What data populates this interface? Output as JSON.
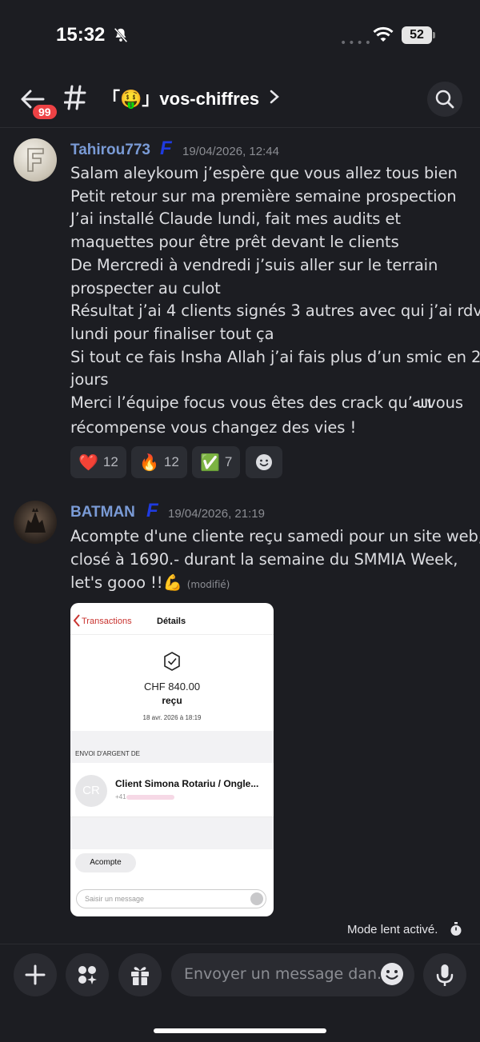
{
  "status_bar": {
    "time": "15:32",
    "battery": "52"
  },
  "header": {
    "unread_count": "99",
    "channel_name": "「🤑」vos-chiffres"
  },
  "messages": [
    {
      "author": "Tahirou773",
      "role_badge": "F",
      "avatar_letter": "F",
      "timestamp": "19/04/2026, 12:44",
      "lines": [
        "Salam aleykoum j’espère que vous allez tous bien",
        "Petit retour sur ma première semaine prospection",
        "J’ai installé Claude lundi, fait mes audits et",
        "maquettes pour être prêt devant le clients",
        "De Mercredi à vendredi j’suis aller sur le terrain",
        "prospecter au culot",
        "Résultat j’ai 4 clients signés 3 autres avec qui j’ai rdv",
        "lundi pour finaliser tout ça",
        "Si tout ce fais Insha Allah j’ai fais plus d’un smic en 2",
        "jours",
        "Merci l’équipe focus vous êtes des crack qu’ﷲ vous",
        "récompense vous changez des vies !"
      ],
      "reactions": [
        {
          "emoji": "❤️",
          "count": "12"
        },
        {
          "emoji": "🔥",
          "count": "12"
        },
        {
          "emoji": "✅",
          "count": "7"
        }
      ]
    },
    {
      "author": "BATMAN",
      "role_badge": "F",
      "timestamp": "19/04/2026, 21:19",
      "lines": [
        "Acompte d'une cliente reçu samedi pour un site web,",
        "closé à 1690.- durant la semaine du SMMIA Week,",
        "let's gooo !!💪"
      ],
      "edited_label": "(modifié)",
      "attachment": {
        "back_label": "Transactions",
        "title": "Détails",
        "amount": "CHF 840.00",
        "status": "reçu",
        "date": "18 avr. 2026 à 18:19",
        "section_label": "ENVOI D'ARGENT DE",
        "contact_initials": "CR",
        "contact_name": "Client Simona Rotariu / Ongle...",
        "contact_phone": "+41",
        "chip_label": "Acompte",
        "input_placeholder": "Saisir un message"
      }
    }
  ],
  "slowmode_label": "Mode lent activé.",
  "composer": {
    "placeholder": "Envoyer un message dan.."
  }
}
